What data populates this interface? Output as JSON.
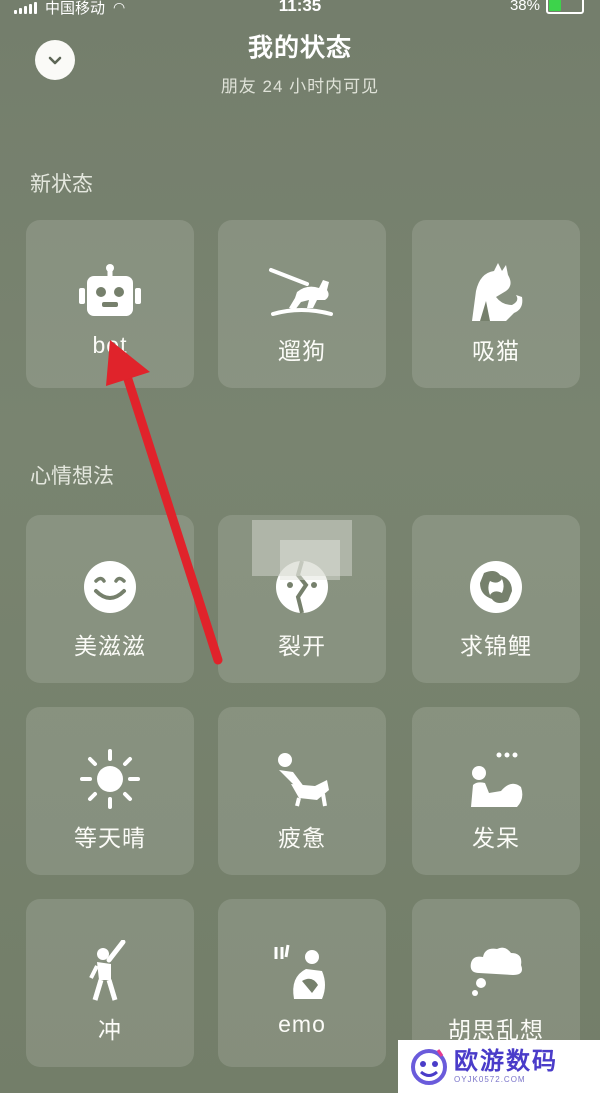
{
  "status_bar": {
    "carrier": "中国移动",
    "time": "11:35",
    "battery": "38%",
    "battery_level": 0.38
  },
  "header": {
    "title": "我的状态",
    "subtitle": "朋友 24 小时内可见"
  },
  "sections": [
    {
      "label": "新状态",
      "items": [
        {
          "label": "bot",
          "icon": "robot-icon"
        },
        {
          "label": "遛狗",
          "icon": "dog-walk-icon"
        },
        {
          "label": "吸猫",
          "icon": "cat-icon"
        }
      ]
    },
    {
      "label": "心情想法",
      "items": [
        {
          "label": "美滋滋",
          "icon": "smile-icon"
        },
        {
          "label": "裂开",
          "icon": "cracked-face-icon"
        },
        {
          "label": "求锦鲤",
          "icon": "koi-icon"
        },
        {
          "label": "等天晴",
          "icon": "sun-icon"
        },
        {
          "label": "疲惫",
          "icon": "tired-person-icon"
        },
        {
          "label": "发呆",
          "icon": "daze-person-icon"
        },
        {
          "label": "冲",
          "icon": "cheer-person-icon"
        },
        {
          "label": "emo",
          "icon": "emo-person-icon"
        },
        {
          "label": "胡思乱想",
          "icon": "thought-cloud-icon"
        }
      ]
    }
  ],
  "watermark": {
    "name": "欧游数码",
    "url": "OYJK0572.COM"
  },
  "colors": {
    "background": "#77816d",
    "annotation_arrow": "#e0232b",
    "watermark_text": "#4a3cc9"
  }
}
